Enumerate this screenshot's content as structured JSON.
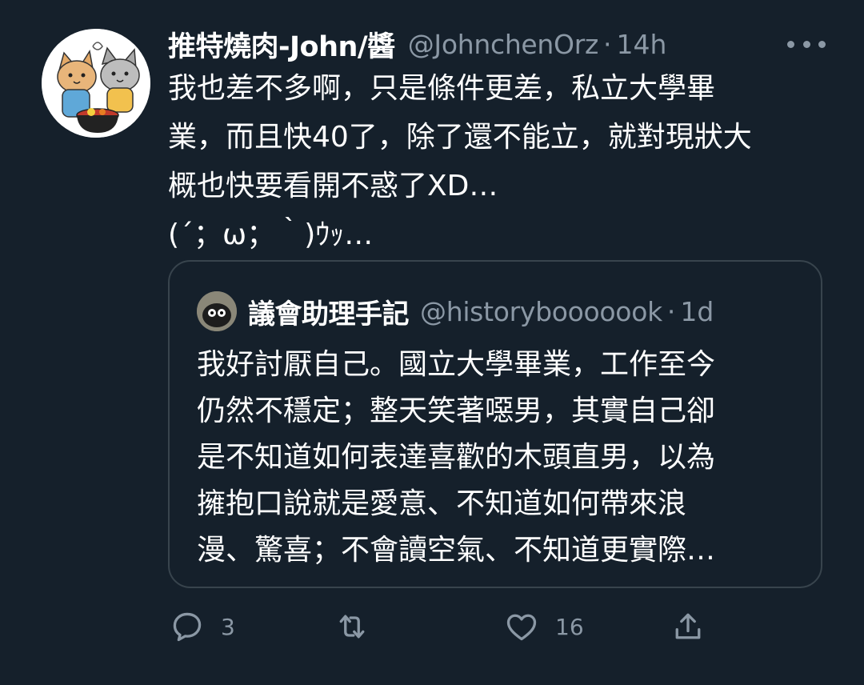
{
  "tweet": {
    "author_name": "推特燒肉-John/醬",
    "handle": "@JohnchenOrz",
    "separator": "·",
    "time": "14h",
    "more_icon": "more-horizontal-icon",
    "body_lines": [
      "我也差不多啊，只是條件更差，私立大學畢",
      "業，而且快40了，除了還不能立，就對現狀大",
      "概也快要看開不惑了XD…",
      "(´；ω；｀)ｳｯ…"
    ]
  },
  "quoted_tweet": {
    "author_name": "議會助理手記",
    "handle": "@historybooooook",
    "separator": "·",
    "time": "1d",
    "body_lines": [
      "我好討厭自己。國立大學畢業，工作至今",
      "仍然不穩定；整天笑著噁男，其實自己卻",
      "是不知道如何表達喜歡的木頭直男，以為",
      "擁抱口說就是愛意、不知道如何帶來浪",
      "漫、驚喜；不會讀空氣、不知道更實際…"
    ]
  },
  "actions": {
    "reply": {
      "icon": "reply-icon",
      "count": "3"
    },
    "retweet": {
      "icon": "retweet-icon",
      "count": ""
    },
    "like": {
      "icon": "like-icon",
      "count": "16"
    },
    "share": {
      "icon": "share-icon",
      "count": ""
    }
  },
  "colors": {
    "background": "#15202b",
    "primary_text": "#ffffff",
    "secondary_text": "#8b98a5",
    "border": "#38444d"
  }
}
